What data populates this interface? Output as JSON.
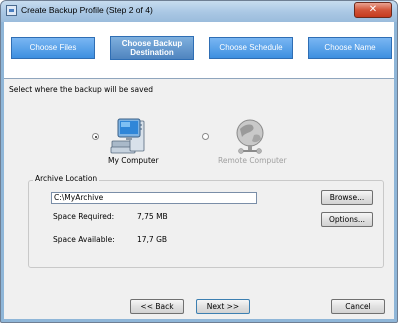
{
  "window": {
    "title": "Create Backup Profile (Step 2 of 4)",
    "close_glyph": "✕"
  },
  "steps": [
    {
      "label": "Choose Files",
      "active": false
    },
    {
      "label_line1": "Choose Backup",
      "label_line2": "Destination",
      "active": true
    },
    {
      "label": "Choose Schedule",
      "active": false
    },
    {
      "label": "Choose Name",
      "active": false
    }
  ],
  "prompt": "Select where the backup will be saved",
  "destinations": [
    {
      "label": "My Computer",
      "selected": true,
      "enabled": true,
      "icon": "computer-icon"
    },
    {
      "label": "Remote Computer",
      "selected": false,
      "enabled": false,
      "icon": "network-globe-icon"
    }
  ],
  "archive": {
    "group_title": "Archive Location",
    "path": "C:\\MyArchive",
    "browse_label": "Browse...",
    "options_label": "Options...",
    "space_required_label": "Space Required:",
    "space_required_value": "7,75 MB",
    "space_available_label": "Space Available:",
    "space_available_value": "17,7 GB"
  },
  "footer": {
    "back_label": "<< Back",
    "next_label": "Next >>",
    "cancel_label": "Cancel"
  }
}
